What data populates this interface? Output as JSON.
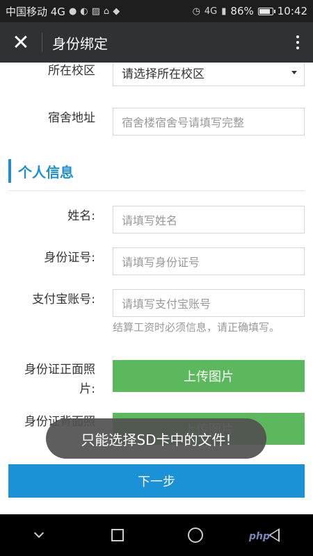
{
  "statusbar": {
    "carrier": "中国移动 4G",
    "icons_left": [
      "wechat-icon",
      "app-icon",
      "image-icon",
      "notification-icon",
      "wifi-icon"
    ],
    "network": "4G",
    "battery": "86%",
    "battery_level": 0.86,
    "time": "10:42"
  },
  "titlebar": {
    "close_glyph": "✕",
    "title": "身份绑定"
  },
  "form": {
    "campus": {
      "label": "所在校区",
      "value": "请选择所在校区"
    },
    "dorm": {
      "label": "宿舍地址",
      "placeholder": "宿舍楼宿舍号请填写完整"
    },
    "section_title": "个人信息",
    "name": {
      "label": "姓名:",
      "placeholder": "请填写姓名"
    },
    "id_number": {
      "label": "身份证号:",
      "placeholder": "请填写身份证号"
    },
    "alipay": {
      "label": "支付宝账号:",
      "placeholder": "请填写支付宝账号",
      "hint": "结算工资时必须信息，请正确填写。"
    },
    "id_front": {
      "label_line1": "身份证正面照",
      "label_line2": "片:",
      "button": "上传图片"
    },
    "id_back": {
      "label_line1": "身份证背面照",
      "button": "上传图片"
    },
    "next_button": "下一步"
  },
  "toast": "只能选择SD卡中的文件!",
  "watermark": "php",
  "colors": {
    "accent": "#1f8fcf",
    "upload_green": "#5cb85c",
    "next_blue": "#1a92d5",
    "titlebar": "#2f3235"
  }
}
